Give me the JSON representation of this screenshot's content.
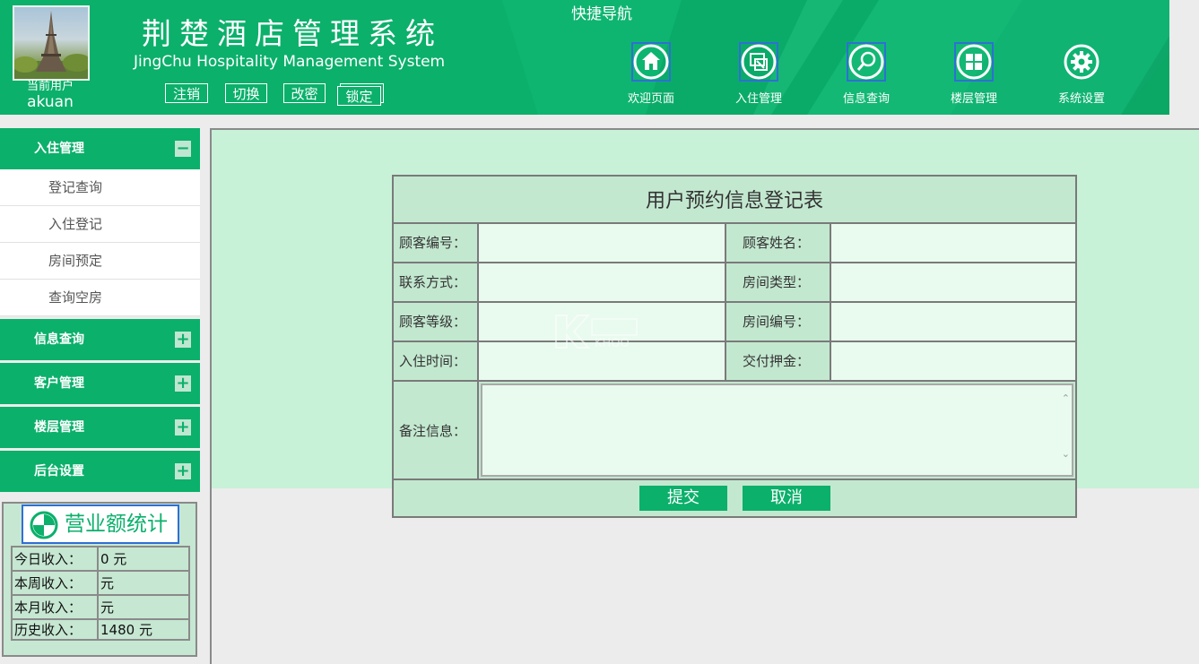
{
  "header": {
    "title_cn": "荆楚酒店管理系统",
    "title_en": "JingChu Hospitality Management System",
    "user_caption": "当前用户",
    "user_name": "akuan",
    "buttons": {
      "logout": "注销",
      "switch": "切换",
      "change_pwd": "改密",
      "lock": "锁定"
    },
    "quick_nav_title": "快捷导航",
    "nav": [
      {
        "label": "欢迎页面",
        "icon": "home-icon"
      },
      {
        "label": "入住管理",
        "icon": "checkin-icon"
      },
      {
        "label": "信息查询",
        "icon": "search-icon"
      },
      {
        "label": "楼层管理",
        "icon": "grid-icon"
      },
      {
        "label": "系统设置",
        "icon": "gear-icon"
      }
    ]
  },
  "sidebar": {
    "sections": [
      {
        "label": "入住管理",
        "toggle": "−",
        "items": [
          "登记查询",
          "入住登记",
          "房间预定",
          "查询空房"
        ]
      },
      {
        "label": "信息查询",
        "toggle": "+"
      },
      {
        "label": "客户管理",
        "toggle": "+"
      },
      {
        "label": "楼层管理",
        "toggle": "+"
      },
      {
        "label": "后台设置",
        "toggle": "+"
      }
    ]
  },
  "stats": {
    "title": "营业额统计",
    "rows": [
      {
        "label": "今日收入：",
        "value": "0 元"
      },
      {
        "label": "本周收入：",
        "value": "元"
      },
      {
        "label": "本月收入：",
        "value": "元"
      },
      {
        "label": "历史收入：",
        "value": "1480 元"
      }
    ]
  },
  "form": {
    "title": "用户预约信息登记表",
    "labels": {
      "customer_id": "顾客编号：",
      "customer_name": "顾客姓名：",
      "contact": "联系方式：",
      "room_type": "房间类型：",
      "customer_level": "顾客等级：",
      "room_no": "房间编号：",
      "checkin_time": "入住时间：",
      "deposit": "交付押金：",
      "remark": "备注信息："
    },
    "submit": "提交",
    "cancel": "取消"
  },
  "colors": {
    "brand": "#0bb06b",
    "panel": "#c7f2d8",
    "cell": "#c3e8d0",
    "input": "#e9faef"
  },
  "watermark": {
    "text": "KHOO"
  }
}
